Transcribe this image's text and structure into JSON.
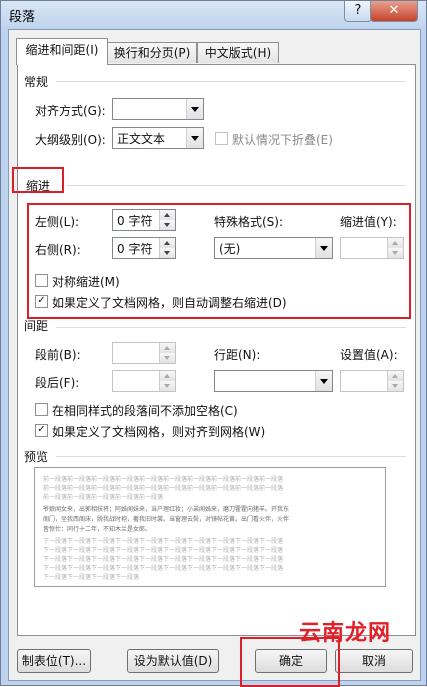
{
  "window": {
    "title": "段落",
    "help_label": "?",
    "close_label": "✕"
  },
  "tabs": [
    {
      "label": "缩进和间距(I)",
      "active": true
    },
    {
      "label": "换行和分页(P)",
      "active": false
    },
    {
      "label": "中文版式(H)",
      "active": false
    }
  ],
  "general": {
    "heading": "常规",
    "alignment_label": "对齐方式(G):",
    "alignment_value": "",
    "outline_label": "大纲级别(O):",
    "outline_value": "正文文本",
    "collapse_label": "默认情况下折叠(E)"
  },
  "indent": {
    "heading": "缩进",
    "left_label": "左侧(L):",
    "left_value": "0 字符",
    "right_label": "右侧(R):",
    "right_value": "0 字符",
    "special_label": "特殊格式(S):",
    "special_value": "(无)",
    "by_label": "缩进值(Y):",
    "by_value": "",
    "mirror_label": "对称缩进(M)",
    "mirror_checked": false,
    "auto_adjust_label": "如果定义了文档网格，则自动调整右缩进(D)",
    "auto_adjust_checked": true
  },
  "spacing": {
    "heading": "间距",
    "before_label": "段前(B):",
    "before_value": "",
    "after_label": "段后(F):",
    "after_value": "",
    "line_label": "行距(N):",
    "line_value": "",
    "at_label": "设置值(A):",
    "at_value": "",
    "no_space_label": "在相同样式的段落间不添加空格(C)",
    "no_space_checked": false,
    "snap_grid_label": "如果定义了文档网格，则对齐到网格(W)",
    "snap_grid_checked": true
  },
  "preview": {
    "heading": "预览",
    "lines": [
      {
        "text": "前一段落前一段落前一段落前一段落前一段落前一段落前一段落前一段落前一段落前一段落",
        "tone": "light"
      },
      {
        "text": "前一段落前一段落前一段落前一段落前一段落前一段落前一段落前一段落前一段落前一段落",
        "tone": "light"
      },
      {
        "text": "前一段落前一段落前一段落前一段落前一段落",
        "tone": "light"
      },
      {
        "text": "爷娘闻女来，出郭相扶将；阿姊闻妹来，当户理红妆；小弟闻姊来，磨刀霍霍向猪羊。开我东",
        "tone": "dark"
      },
      {
        "text": "阁门，坐我西阁床，脱我战时袍，著我旧时裳。当窗理云鬓，对镜帖花黄。出门看火伴，火伴",
        "tone": "dark"
      },
      {
        "text": "皆惊忙：同行十二年，不知木兰是女郎。",
        "tone": "dark"
      },
      {
        "text": "下一段落下一段落下一段落下一段落下一段落下一段落下一段落下一段落下一段落下一段落",
        "tone": "light"
      },
      {
        "text": "下一段落下一段落下一段落下一段落下一段落下一段落下一段落下一段落下一段落下一段落",
        "tone": "light"
      },
      {
        "text": "下一段落下一段落下一段落下一段落下一段落下一段落下一段落下一段落下一段落下一段落",
        "tone": "light"
      },
      {
        "text": "下一段落下一段落下一段落下一段落下一段落下一段落下一段落下一段落下一段落下一段落",
        "tone": "light"
      },
      {
        "text": "下一段落下一段落下一段落下一段落",
        "tone": "light"
      }
    ]
  },
  "buttons": {
    "tabs_label": "制表位(T)...",
    "default_label": "设为默认值(D)",
    "ok_label": "确定",
    "cancel_label": "取消"
  },
  "watermark": "云南龙网",
  "colors": {
    "highlight_box": "#d9202a",
    "window_frame": "#bcd2ee"
  }
}
